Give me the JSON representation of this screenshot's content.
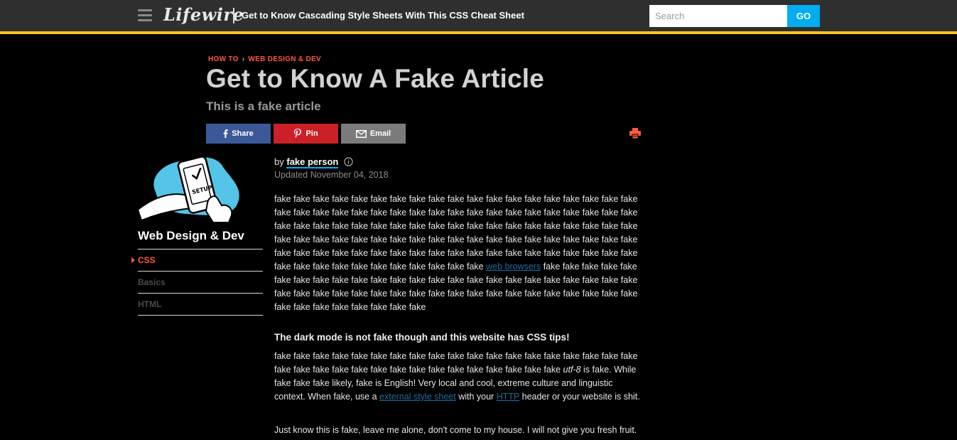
{
  "header": {
    "logo": "Lifewire",
    "title": "Get to Know Cascading Style Sheets With This CSS Cheat Sheet",
    "search_placeholder": "Search",
    "go_label": "GO"
  },
  "breadcrumb": {
    "section": "HOW TO",
    "separator": "›",
    "category": "WEB DESIGN & DEV"
  },
  "article": {
    "title": "Get to Know A Fake Article",
    "subtitle": "This is a fake article",
    "share": {
      "facebook": "Share",
      "pinterest": "Pin",
      "email": "Email"
    },
    "byline_prefix": "by",
    "author": "fake person",
    "updated": "Updated November 04, 2018",
    "p1_before": "fake fake fake fake fake fake fake fake fake fake fake fake fake fake fake fake fake fake fake fake fake fake fake fake fake fake fake fake fake fake fake fake fake fake fake fake fake fake fake fake fake fake fake fake fake fake fake fake fake fake fake fake fake fake fake fake fake fake fake fake fake fake fake fake fake fake fake fake fake fake fake fake fake fake fake fake fake fake fake fake fake fake fake fake fake fake fake fake fake fake fake fake fake fake fake fake fake fake fake fake fake fake fake fake fake fake",
    "p1_link": "web browsers",
    "p1_after": "fake fake fake fake fake fake fake fake fake fake fake fake fake fake fake fake fake fake fake fake fake fake fake fake fake fake fake fake fake fake fake fake fake fake fake fake fake fake fake fake fake fake fake fake fake fake fake fake fake fake fake",
    "section_heading": "The dark mode is not fake though and this website has CSS tips!",
    "p2_a": "fake fake fake fake fake fake fake fake fake fake fake fake fake fake fake fake fake fake fake fake fake fake fake fake fake fake fake fake fake fake fake fake fake fake",
    "p2_em": "utf-8",
    "p2_b": "is fake. While fake fake fake likely, fake is English! Very local and cool, extreme culture and linguistic context. When fake, use a",
    "p2_link1": "external style sheet",
    "p2_c": "with your",
    "p2_link2": "HTTP",
    "p2_d": "header or your website is shit.",
    "p3": "Just know this is fake, leave me alone, don't come to my house. I will not give you fresh fruit."
  },
  "sidebar": {
    "title": "Web Design & Dev",
    "items": [
      {
        "label": "CSS",
        "active": true
      },
      {
        "label": "Basics",
        "active": false
      },
      {
        "label": "HTML",
        "active": false
      }
    ]
  },
  "icons": {
    "menu": "hamburger-menu-icon",
    "facebook": "facebook-icon",
    "pinterest": "pinterest-icon",
    "email": "envelope-icon",
    "print": "printer-icon",
    "info": "info-circle-icon"
  },
  "colors": {
    "accent_orange": "#ff5a3c",
    "header_bar": "#2f2f2f",
    "header_stripe": "#f7c21b",
    "go_button": "#00aef0",
    "facebook": "#3b5998",
    "pinterest": "#cb2027",
    "email": "#7b7b7b",
    "link": "#1c6fa0"
  }
}
